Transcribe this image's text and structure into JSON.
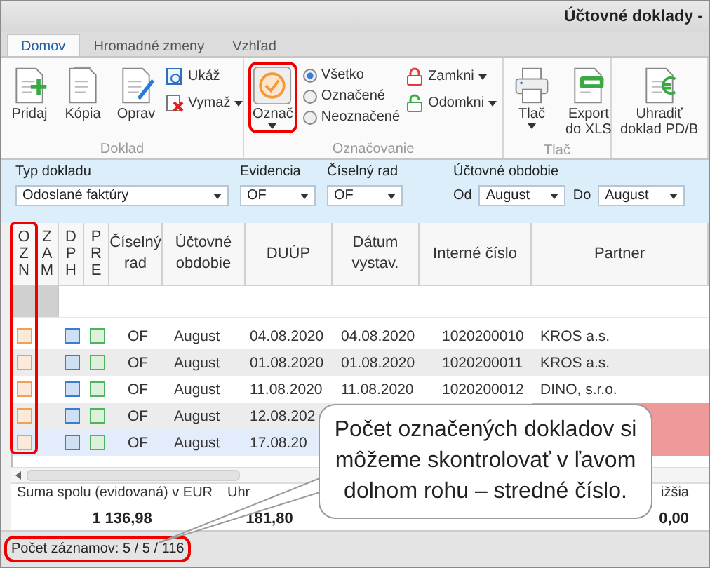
{
  "window": {
    "title": "Účtovné doklady -"
  },
  "tabs": [
    {
      "label": "Domov",
      "selected": true
    },
    {
      "label": "Hromadné zmeny",
      "selected": false
    },
    {
      "label": "Vzhľad",
      "selected": false
    }
  ],
  "ribbon": [
    {
      "label": "Doklad",
      "items": [
        {
          "kind": "large",
          "label": "Pridaj",
          "dropdown": false
        },
        {
          "kind": "large",
          "label": "Kópia",
          "dropdown": false
        },
        {
          "kind": "large",
          "label": "Oprav",
          "dropdown": false
        },
        {
          "kind": "stack",
          "items": [
            {
              "label": "Ukáž",
              "dropdown": false
            },
            {
              "label": "Vymaž",
              "dropdown": true
            }
          ]
        }
      ]
    },
    {
      "label": "Označovanie",
      "items": [
        {
          "kind": "large",
          "label": "Označ",
          "dropdown": true,
          "highlighted": true
        },
        {
          "kind": "radios",
          "items": [
            {
              "label": "Všetko",
              "selected": true
            },
            {
              "label": "Označené",
              "selected": false
            },
            {
              "label": "Neoznačené",
              "selected": false
            }
          ]
        },
        {
          "kind": "stack",
          "items": [
            {
              "label": "Zamkni",
              "dropdown": true
            },
            {
              "label": "Odomkni",
              "dropdown": true
            }
          ]
        }
      ]
    },
    {
      "label": "Tlač",
      "items": [
        {
          "kind": "large",
          "label": "Tlač",
          "dropdown": true
        },
        {
          "kind": "large",
          "label": "Export\ndo XLS",
          "dropdown": false
        }
      ]
    },
    {
      "items": [
        {
          "kind": "large",
          "label": "Uhradiť\ndoklad PD/B",
          "dropdown": false
        }
      ]
    }
  ],
  "filters": {
    "type": {
      "label": "Typ dokladu",
      "value": "Odoslané faktúry"
    },
    "evidence": {
      "label": "Evidencia",
      "value": "OF"
    },
    "series": {
      "label": "Číselný rad",
      "value": "OF"
    },
    "period": {
      "label": "Účtovné obdobie",
      "from_label": "Od",
      "from": "August",
      "to_label": "Do",
      "to": "August"
    }
  },
  "table": {
    "columns": [
      "OZN",
      "ZAM",
      "DPH",
      "PRE",
      "Číselný\nrad",
      "Účtovné\nobdobie",
      "DUÚP",
      "Dátum\nvystav.",
      "Interné číslo",
      "Partner"
    ],
    "first_column_highlighted": true,
    "rows": [
      {
        "selected": false,
        "overdue": false,
        "cells": [
          {
            "checked": false
          },
          "",
          {
            "checked": false
          },
          {
            "checked": false
          },
          "OF",
          "August",
          "04.08.2020",
          "04.08.2020",
          "1020200010",
          "KROS a.s."
        ]
      },
      {
        "selected": false,
        "overdue": false,
        "cells": [
          {
            "checked": false
          },
          "",
          {
            "checked": false
          },
          {
            "checked": false
          },
          "OF",
          "August",
          "01.08.2020",
          "01.08.2020",
          "1020200011",
          "KROS a.s."
        ]
      },
      {
        "selected": false,
        "overdue": false,
        "cells": [
          {
            "checked": false
          },
          "",
          {
            "checked": false
          },
          {
            "checked": false
          },
          "OF",
          "August",
          "11.08.2020",
          "11.08.2020",
          "1020200012",
          "DINO, s.r.o."
        ]
      },
      {
        "selected": false,
        "overdue": true,
        "cells": [
          {
            "checked": false
          },
          "",
          {
            "checked": false
          },
          {
            "checked": false
          },
          "OF",
          "August",
          "12.08.202",
          "",
          "",
          ""
        ]
      },
      {
        "selected": true,
        "overdue": true,
        "cells": [
          {
            "checked": false
          },
          "",
          {
            "checked": false
          },
          {
            "checked": false
          },
          "OF",
          "August",
          "17.08.20",
          "",
          "",
          ""
        ]
      }
    ]
  },
  "sums": [
    {
      "label": "Suma spolu (evidovaná) v EUR",
      "value": "1 136,98"
    },
    {
      "label": "Uhr",
      "value": "181,80"
    },
    {
      "label": "ižšia",
      "value": "0,00"
    }
  ],
  "status_bar": {
    "text": "Počet záznamov: 5 / 5 / 116",
    "highlighted": true
  },
  "callout": {
    "text": "Počet označených dokladov si môžeme skontrolovať v ľavom dolnom rohu – stredné číslo."
  }
}
